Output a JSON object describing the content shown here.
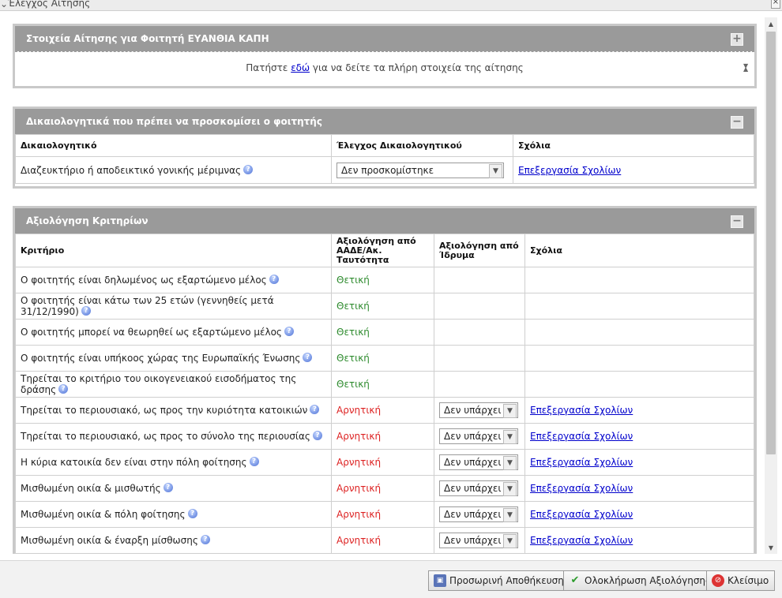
{
  "window": {
    "title": "Έλεγχος Αίτησης",
    "close_glyph": "×"
  },
  "panel1": {
    "title": "Στοιχεία Αίτησης για Φοιτητή ΕΥΑΝΘΙΑ ΚΑΠΗ",
    "toggle": "+",
    "text_before": "Πατήστε ",
    "link": "εδώ",
    "text_after": " για να δείτε τα πλήρη στοιχεία της αίτησης"
  },
  "panel2": {
    "title": "Δικαιολογητικά που πρέπει να προσκομίσει ο φοιτητής",
    "toggle": "−",
    "headers": [
      "Δικαιολογητικό",
      "Έλεγχος Δικαιολογητικού",
      "Σχόλια"
    ],
    "rows": [
      {
        "doc": "Διαζευκτήριο ή αποδεικτικό γονικής μέριμνας",
        "check": "Δεν προσκομίστηκε",
        "comments": "Επεξεργασία Σχολίων"
      }
    ]
  },
  "panel3": {
    "title": "Αξιολόγηση Κριτηρίων",
    "toggle": "−",
    "headers": [
      "Κριτήριο",
      "Αξιολόγηση από ΑΑΔΕ/Ακ. Ταυτότητα",
      "Αξιολόγηση από Ίδρυμα",
      "Σχόλια"
    ],
    "rows": [
      {
        "criterion": "Ο φοιτητής είναι δηλωμένος ως εξαρτώμενο μέλος",
        "aade": "Θετική",
        "aade_status": "positive",
        "idryma": "",
        "comments": ""
      },
      {
        "criterion": "Ο φοιτητής είναι κάτω των 25 ετών (γεννηθείς μετά 31/12/1990)",
        "aade": "Θετική",
        "aade_status": "positive",
        "idryma": "",
        "comments": ""
      },
      {
        "criterion": "Ο φοιτητής μπορεί να θεωρηθεί ως εξαρτώμενο μέλος",
        "aade": "Θετική",
        "aade_status": "positive",
        "idryma": "",
        "comments": ""
      },
      {
        "criterion": "Ο φοιτητής είναι υπήκοος χώρας της Ευρωπαϊκής Ένωσης",
        "aade": "Θετική",
        "aade_status": "positive",
        "idryma": "",
        "comments": ""
      },
      {
        "criterion": "Τηρείται το κριτήριο του οικογενειακού εισοδήματος της δράσης",
        "aade": "Θετική",
        "aade_status": "positive",
        "idryma": "",
        "comments": ""
      },
      {
        "criterion": "Τηρείται το περιουσιακό, ως προς την κυριότητα κατοικιών",
        "aade": "Αρνητική",
        "aade_status": "negative",
        "idryma": "Δεν υπάρχει",
        "comments": "Επεξεργασία Σχολίων"
      },
      {
        "criterion": "Τηρείται το περιουσιακό, ως προς το σύνολο της περιουσίας",
        "aade": "Αρνητική",
        "aade_status": "negative",
        "idryma": "Δεν υπάρχει",
        "comments": "Επεξεργασία Σχολίων"
      },
      {
        "criterion": "Η κύρια κατοικία δεν είναι στην πόλη φοίτησης",
        "aade": "Αρνητική",
        "aade_status": "negative",
        "idryma": "Δεν υπάρχει",
        "comments": "Επεξεργασία Σχολίων"
      },
      {
        "criterion": "Μισθωμένη οικία & μισθωτής",
        "aade": "Αρνητική",
        "aade_status": "negative",
        "idryma": "Δεν υπάρχει",
        "comments": "Επεξεργασία Σχολίων"
      },
      {
        "criterion": "Μισθωμένη οικία & πόλη φοίτησης",
        "aade": "Αρνητική",
        "aade_status": "negative",
        "idryma": "Δεν υπάρχει",
        "comments": "Επεξεργασία Σχολίων"
      },
      {
        "criterion": "Μισθωμένη οικία & έναρξη μίσθωσης",
        "aade": "Αρνητική",
        "aade_status": "negative",
        "idryma": "Δεν υπάρχει",
        "comments": "Επεξεργασία Σχολίων"
      }
    ]
  },
  "footer": {
    "save_button": "Προσωρινή Αποθήκευση",
    "complete_button": "Ολοκλήρωση Αξιολόγησης",
    "close_button": "Κλείσιμο"
  },
  "icons": {
    "help": "question-circle-icon",
    "dropdown": "chevron-down-icon",
    "save": "floppy-disk-icon",
    "complete": "check-icon",
    "close": "close-circle-icon"
  },
  "colors": {
    "positive": "#2e8b2e",
    "negative": "#d22222",
    "header_bg": "#9a9a9a",
    "link": "#0000cc"
  }
}
